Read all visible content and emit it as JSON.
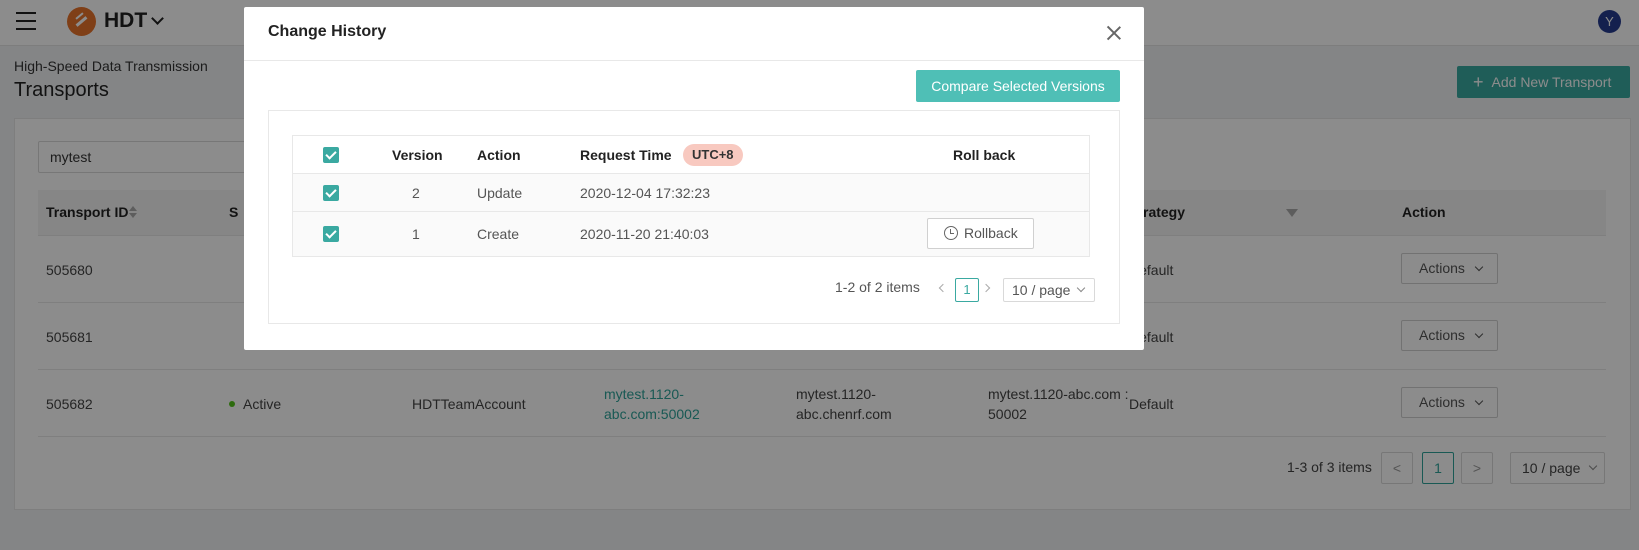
{
  "topbar": {
    "app_name": "HDT",
    "avatar_initial": "Y"
  },
  "breadcrumb": "High-Speed Data Transmission",
  "page_title": "Transports",
  "add_button_label": "Add New Transport",
  "search": {
    "value": "mytest"
  },
  "table": {
    "headers": {
      "transport_id": "Transport ID",
      "status_partial": "S",
      "strategy": "Strategy",
      "action": "Action"
    },
    "rows": [
      {
        "id": "505680",
        "status": "",
        "account": "",
        "endpoint": "",
        "host": "",
        "address": "",
        "strategy": "Default",
        "action": "Actions"
      },
      {
        "id": "505681",
        "status": "",
        "account": "",
        "endpoint": "",
        "host": "",
        "address": "",
        "strategy": "Default",
        "action": "Actions"
      },
      {
        "id": "505682",
        "status": "Active",
        "account": "HDTTeamAccount",
        "endpoint": "mytest.1120-abc.com:50002",
        "host": "mytest.1120-abc.chenrf.com",
        "address": "mytest.1120-abc.com : 50002",
        "strategy": "Default",
        "action": "Actions"
      }
    ],
    "row3_lines": {
      "endpoint_1": "mytest.1120-",
      "endpoint_2": "abc.com:50002",
      "host_1": "mytest.1120-",
      "host_2": "abc.chenrf.com",
      "address_1": "mytest.1120-abc.com :",
      "address_2": "50002"
    },
    "pagination": {
      "total": "1-3 of 3 items",
      "prev": "<",
      "current": "1",
      "next": ">",
      "page_size": "10 / page"
    }
  },
  "modal": {
    "title": "Change History",
    "compare_button": "Compare Selected Versions",
    "headers": {
      "version": "Version",
      "action": "Action",
      "request_time": "Request Time",
      "timezone": "UTC+8",
      "rollback": "Roll back"
    },
    "rows": [
      {
        "version": "2",
        "action": "Update",
        "time": "2020-12-04 17:32:23",
        "checked": true
      },
      {
        "version": "1",
        "action": "Create",
        "time": "2020-11-20 21:40:03",
        "checked": true,
        "rollback_label": "Rollback"
      }
    ],
    "pagination": {
      "total": "1-2 of 2 items",
      "current": "1",
      "page_size": "10 / page"
    }
  },
  "colors": {
    "accent": "#3aa9a1",
    "brand": "#e8732a",
    "utc_badge": "#f8c9c0",
    "status_active": "#52c41a"
  }
}
